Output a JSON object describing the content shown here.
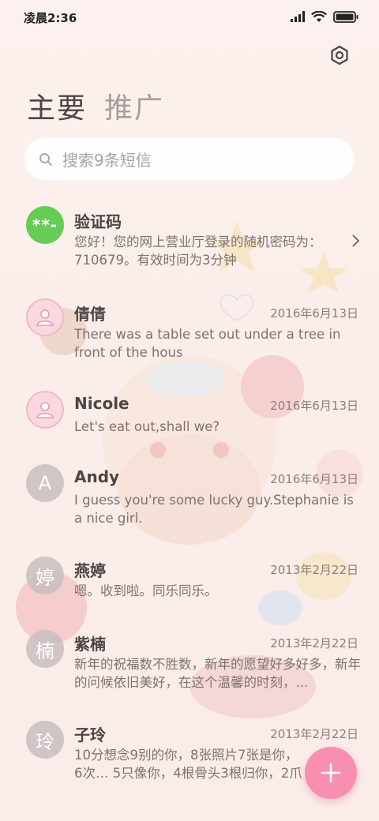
{
  "status": {
    "time": "凌晨2:36"
  },
  "tabs": [
    {
      "label": "主要",
      "active": true
    },
    {
      "label": "推广",
      "active": false
    }
  ],
  "search": {
    "placeholder": "搜索9条短信"
  },
  "conversations": [
    {
      "avatar": "**-",
      "avatar_style": "green",
      "name": "验证码",
      "date": "",
      "message": "您好！您的网上营业厅登录的随机密码为：710679。有效时间为3分钟",
      "has_chevron": true
    },
    {
      "avatar": "person-icon",
      "avatar_style": "pink",
      "name": "倩倩",
      "date": "2016年6月13日",
      "message": "There was a table set out under a tree in front of the hous"
    },
    {
      "avatar": "person-icon",
      "avatar_style": "pink",
      "name": "Nicole",
      "date": "2016年6月13日",
      "message": "Let's eat out,shall we?"
    },
    {
      "avatar": "A",
      "avatar_style": "gray",
      "name": "Andy",
      "date": "2016年6月13日",
      "message": "I guess you're some lucky guy.Stephanie is a nice girl."
    },
    {
      "avatar": "婷",
      "avatar_style": "gray",
      "name": "燕婷",
      "date": "2013年2月22日",
      "message": "嗯。收到啦。同乐同乐。"
    },
    {
      "avatar": "楠",
      "avatar_style": "gray",
      "name": "紫楠",
      "date": "2013年2月22日",
      "message": "新年的祝福数不胜数，新年的愿望好多好多，新年的问候依旧美好，在这个温馨的时刻，..."
    },
    {
      "avatar": "玲",
      "avatar_style": "gray",
      "name": "子玲",
      "date": "2013年2月22日",
      "message": "10分想念9别的你，8张照片7张是你，6次… 5只像你，4根骨头3根归你，2爪着地1…"
    }
  ],
  "colors": {
    "accent": "#f88fb0",
    "green_avatar": "#66cc55"
  }
}
